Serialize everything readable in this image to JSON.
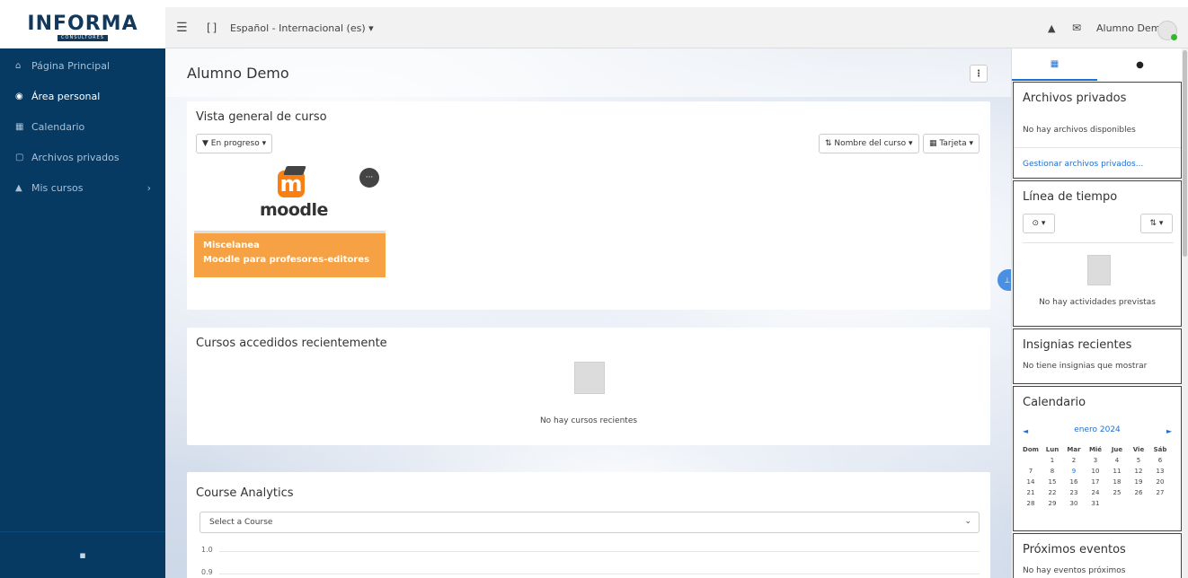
{
  "topbar": {
    "brand": "INFORMA",
    "brand_sub": "CONSULTORES",
    "menu_icon": "☰",
    "fullscreen_icon": "[ ]",
    "language": "Español - Internacional (es) ▾",
    "bell_icon": "▲",
    "mail_icon": "✉",
    "user_name": "Alumno Demo"
  },
  "sidebar": {
    "items": [
      {
        "icon": "⌂",
        "label": "Página Principal"
      },
      {
        "icon": "◉",
        "label": "Área personal"
      },
      {
        "icon": "▦",
        "label": "Calendario"
      },
      {
        "icon": "▢",
        "label": "Archivos privados"
      },
      {
        "icon": "▲",
        "label": "Mis cursos",
        "chevron": "›"
      }
    ],
    "bottom_icon": "▪"
  },
  "main": {
    "title": "Alumno Demo",
    "header_btn": "⋮",
    "overview": {
      "title": "Vista general de curso",
      "filter": "▼ En progreso ▾",
      "sort": "⇅ Nombre del curso ▾",
      "view": "▦ Tarjeta ▾",
      "course": {
        "logo_letter": "m",
        "logo_word": "moodle",
        "menu": "···",
        "category": "Miscelanea",
        "name": "Moodle para profesores-editores"
      }
    },
    "recent": {
      "title": "Cursos accedidos recientemente",
      "empty": "No hay cursos recientes"
    },
    "analytics": {
      "title": "Course Analytics",
      "select": "Select a Course",
      "select_arrow": "⌄",
      "y_top": "1.0",
      "y_next": "0.9"
    },
    "pin_icon": "⊥"
  },
  "drawer": {
    "tab_blocks_icon": "▦",
    "tab_messages_icon": "●",
    "private_files": {
      "title": "Archivos privados",
      "empty": "No hay archivos disponibles",
      "link": "Gestionar archivos privados..."
    },
    "timeline": {
      "title": "Línea de tiempo",
      "filter": "⊙ ▾",
      "sort": "⇅ ▾",
      "empty": "No hay actividades previstas"
    },
    "badges": {
      "title": "Insignias recientes",
      "empty": "No tiene insignias que mostrar"
    },
    "calendar": {
      "title": "Calendario",
      "prev": "◄",
      "next": "►",
      "month": "enero 2024",
      "days": [
        "Dom",
        "Lun",
        "Mar",
        "Mié",
        "Jue",
        "Vie",
        "Sáb"
      ],
      "weeks": [
        [
          "",
          "1",
          "2",
          "3",
          "4",
          "5",
          "6"
        ],
        [
          "7",
          "8",
          "9",
          "10",
          "11",
          "12",
          "13"
        ],
        [
          "14",
          "15",
          "16",
          "17",
          "18",
          "19",
          "20"
        ],
        [
          "21",
          "22",
          "23",
          "24",
          "25",
          "26",
          "27"
        ],
        [
          "28",
          "29",
          "30",
          "31",
          "",
          "",
          ""
        ]
      ],
      "today": "9"
    },
    "upcoming": {
      "title": "Próximos eventos",
      "empty": "No hay eventos próximos"
    }
  }
}
